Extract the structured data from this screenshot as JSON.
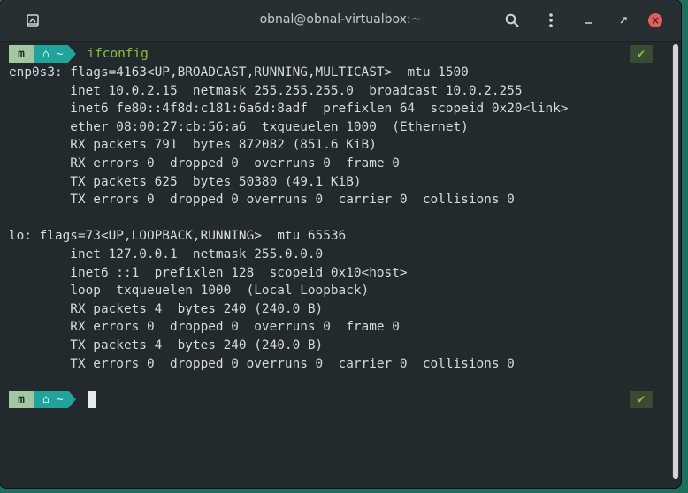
{
  "window": {
    "title": "obnal@obnal-virtualbox:~"
  },
  "titlebar": {
    "new_tab_icon": "new-tab-icon",
    "search_icon": "search-icon",
    "menu_icon": "menu-icon",
    "minimize_icon": "minimize-icon",
    "maximize_icon": "maximize-icon",
    "close_icon": "close-icon",
    "close_color": "#e95c5c"
  },
  "prompt": {
    "logo_glyph": "m",
    "home_label": "~",
    "status_symbol": "✔",
    "colors": {
      "logo": "#a3c7a0",
      "home": "#1fa39a",
      "command": "#8dbf3e"
    }
  },
  "command": "ifconfig",
  "output": [
    "enp0s3: flags=4163<UP,BROADCAST,RUNNING,MULTICAST>  mtu 1500",
    "        inet 10.0.2.15  netmask 255.255.255.0  broadcast 10.0.2.255",
    "        inet6 fe80::4f8d:c181:6a6d:8adf  prefixlen 64  scopeid 0x20<link>",
    "        ether 08:00:27:cb:56:a6  txqueuelen 1000  (Ethernet)",
    "        RX packets 791  bytes 872082 (851.6 KiB)",
    "        RX errors 0  dropped 0  overruns 0  frame 0",
    "        TX packets 625  bytes 50380 (49.1 KiB)",
    "        TX errors 0  dropped 0 overruns 0  carrier 0  collisions 0",
    "",
    "lo: flags=73<UP,LOOPBACK,RUNNING>  mtu 65536",
    "        inet 127.0.0.1  netmask 255.0.0.0",
    "        inet6 ::1  prefixlen 128  scopeid 0x10<host>",
    "        loop  txqueuelen 1000  (Local Loopback)",
    "        RX packets 4  bytes 240 (240.0 B)",
    "        RX errors 0  dropped 0  overruns 0  frame 0",
    "        TX packets 4  bytes 240 (240.0 B)",
    "        TX errors 0  dropped 0 overruns 0  carrier 0  collisions 0"
  ]
}
